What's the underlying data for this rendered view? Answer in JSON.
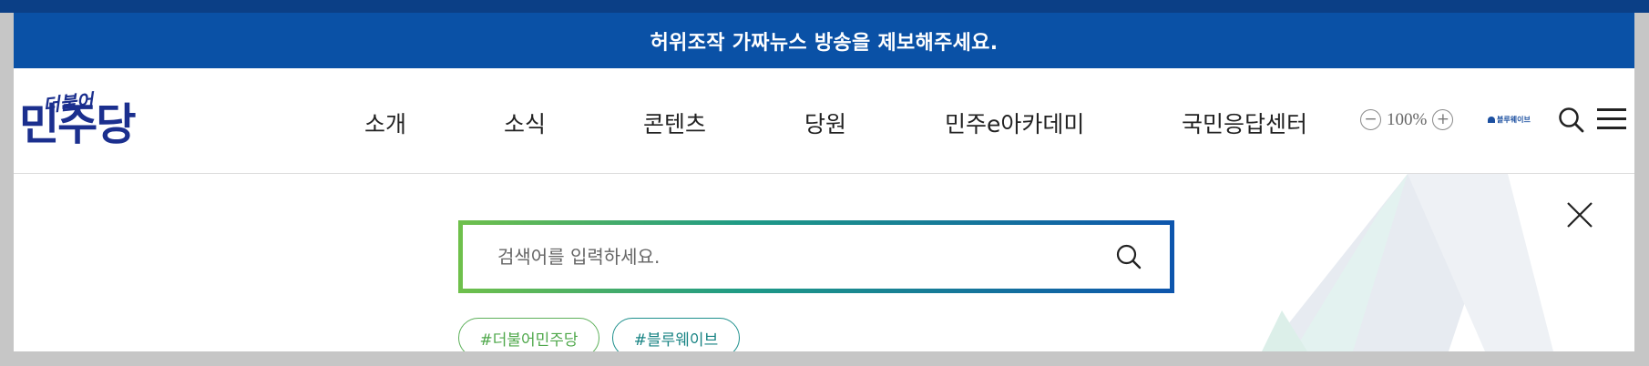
{
  "banner": {
    "text": "허위조작 가짜뉴스 방송을 제보해주세요."
  },
  "logo": {
    "small_text": "더불어",
    "big_text": "민주당"
  },
  "nav": {
    "items": [
      "소개",
      "소식",
      "콘텐츠",
      "당원",
      "민주e아카데미",
      "국민응답센터"
    ]
  },
  "zoom": {
    "minus": "−",
    "value": "100%",
    "plus": "+"
  },
  "bluewave_logo": {
    "text": "블루웨이브"
  },
  "icons": {
    "search": "search-icon",
    "menu": "hamburger-menu-icon",
    "close": "close-icon",
    "search_submit": "search-icon"
  },
  "search": {
    "placeholder": "검색어를 입력하세요.",
    "value": ""
  },
  "tags": [
    "#더불어민주당",
    "#블루웨이브"
  ],
  "colors": {
    "banner": "#0a51a6",
    "brand_navy": "#1b2f8e",
    "tag_green": "#4fa84b",
    "tag_teal": "#178383",
    "gradient_start": "#6fc04b",
    "gradient_end": "#0d55ad"
  }
}
